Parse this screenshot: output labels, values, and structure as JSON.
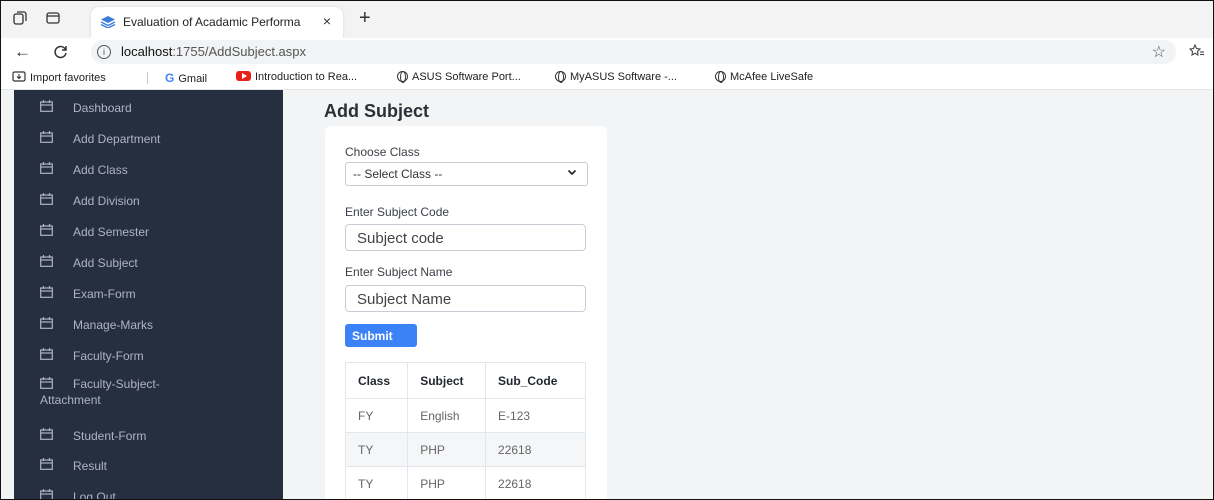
{
  "browser": {
    "tab_title": "Evaluation of Acadamic Performa",
    "tab_close": "×",
    "new_tab": "+",
    "url_host": "localhost",
    "url_path": ":1755/AddSubject.aspx",
    "bookmarks": [
      {
        "label": "Import favorites",
        "icon": "import-icon"
      },
      {
        "label": "Gmail",
        "icon": "gmail-icon"
      },
      {
        "label": "Introduction to Rea...",
        "icon": "youtube-icon"
      },
      {
        "label": "ASUS Software Port...",
        "icon": "globe-icon"
      },
      {
        "label": "MyASUS Software -...",
        "icon": "globe-icon"
      },
      {
        "label": "McAfee LiveSafe",
        "icon": "globe-icon"
      }
    ]
  },
  "sidebar": {
    "items": [
      {
        "label": "Dashboard"
      },
      {
        "label": "Add Department"
      },
      {
        "label": "Add Class"
      },
      {
        "label": "Add Division"
      },
      {
        "label": "Add Semester"
      },
      {
        "label": "Add Subject"
      },
      {
        "label": "Exam-Form"
      },
      {
        "label": "Manage-Marks"
      },
      {
        "label": "Faculty-Form"
      },
      {
        "label": "Faculty-Subject-Attachment"
      },
      {
        "label": "Student-Form"
      },
      {
        "label": "Result"
      },
      {
        "label": "Log Out"
      }
    ]
  },
  "form": {
    "title": "Add Subject",
    "class_label": "Choose Class",
    "class_selected": "-- Select Class --",
    "code_label": "Enter Subject Code",
    "code_placeholder": "Subject code",
    "name_label": "Enter Subject Name",
    "name_placeholder": "Subject Name",
    "submit_label": "Submit"
  },
  "table": {
    "headers": [
      "Class",
      "Subject",
      "Sub_Code"
    ],
    "rows": [
      [
        "FY",
        "English",
        "E-123"
      ],
      [
        "TY",
        "PHP",
        "22618"
      ],
      [
        "TY",
        "PHP",
        "22618"
      ]
    ]
  },
  "colors": {
    "sidebar_bg": "#262f40",
    "accent": "#3b82f6",
    "page_bg": "#f2f4f6"
  }
}
